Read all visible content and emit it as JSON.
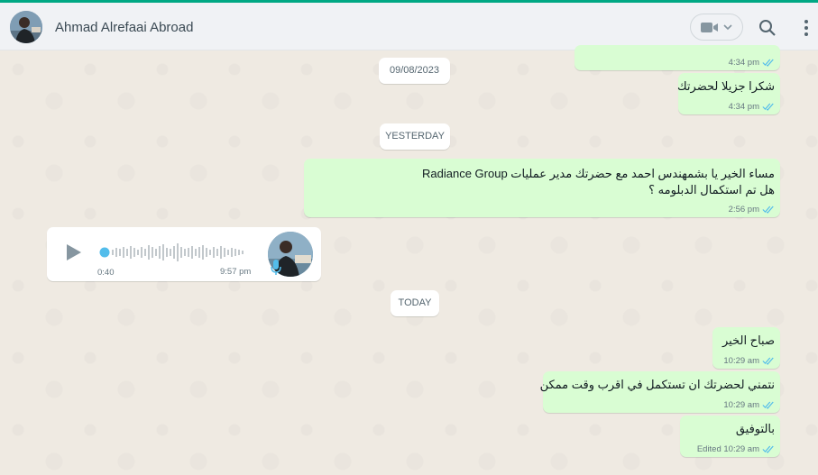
{
  "header": {
    "contact_name": "Ahmad Alrefaai Abroad"
  },
  "dates": {
    "first": "09/08/2023",
    "second": "YESTERDAY",
    "third": "TODAY"
  },
  "messages": [
    {
      "text": "",
      "time": "4:34 pm"
    },
    {
      "text": "شكرا جزيلا لحضرتك",
      "time": "4:34 pm"
    },
    {
      "line1": "مساء الخير يا بشمهندس احمد مع حضرتك مدير عمليات Radiance Group",
      "line2": "هل تم استكمال الدبلومه ؟",
      "time": "2:56 pm"
    },
    {
      "duration": "0:40",
      "time": "9:57 pm"
    },
    {
      "text": "صباح الخير",
      "time": "10:29 am"
    },
    {
      "text": "نتمني لحضرتك ان تستكمل في اقرب وقت ممكن",
      "time": "10:29 am"
    },
    {
      "text": "بالتوفيق",
      "time": "Edited 10:29 am"
    }
  ],
  "colors": {
    "accent": "#00a884",
    "outgoing_bubble": "#d9fdd3",
    "incoming_bubble": "#ffffff",
    "read_ticks": "#53bdeb",
    "chat_background": "#efeae2"
  },
  "icons": {
    "video": "video-camera-icon",
    "search": "search-icon",
    "menu": "kebab-menu-icon",
    "play": "play-icon",
    "mic": "microphone-icon"
  }
}
